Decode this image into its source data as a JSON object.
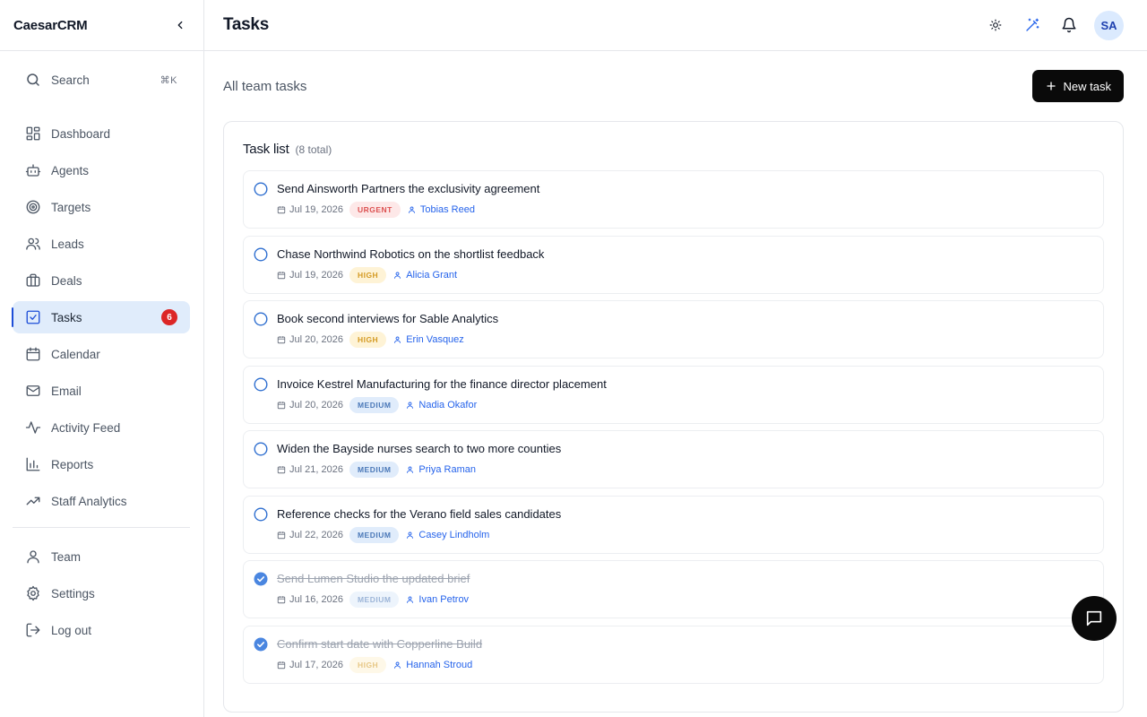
{
  "app": {
    "name": "CaesarCRM"
  },
  "sidebar": {
    "search": {
      "label": "Search",
      "shortcut": "⌘K"
    },
    "items": [
      {
        "label": "Dashboard",
        "icon": "dashboard-icon"
      },
      {
        "label": "Agents",
        "icon": "bot-icon"
      },
      {
        "label": "Targets",
        "icon": "target-icon"
      },
      {
        "label": "Leads",
        "icon": "users-icon"
      },
      {
        "label": "Deals",
        "icon": "briefcase-icon"
      },
      {
        "label": "Tasks",
        "icon": "checkbox-icon",
        "active": true,
        "badge": "6"
      },
      {
        "label": "Calendar",
        "icon": "calendar-icon"
      },
      {
        "label": "Email",
        "icon": "mail-icon"
      },
      {
        "label": "Activity Feed",
        "icon": "activity-icon"
      },
      {
        "label": "Reports",
        "icon": "bar-chart-icon"
      },
      {
        "label": "Staff Analytics",
        "icon": "trending-up-icon"
      }
    ],
    "bottom_items": [
      {
        "label": "Team",
        "icon": "user-icon"
      },
      {
        "label": "Settings",
        "icon": "gear-icon"
      },
      {
        "label": "Log out",
        "icon": "logout-icon"
      }
    ]
  },
  "header": {
    "title": "Tasks",
    "avatar_initials": "SA"
  },
  "main": {
    "subtitle": "All team tasks",
    "new_task_label": "New task",
    "card_title": "Task list",
    "card_count": "(8 total)"
  },
  "tasks": [
    {
      "title": "Send Ainsworth Partners the exclusivity agreement",
      "date": "Jul 19, 2026",
      "priority": "URGENT",
      "assignee": "Tobias Reed",
      "done": false
    },
    {
      "title": "Chase Northwind Robotics on the shortlist feedback",
      "date": "Jul 19, 2026",
      "priority": "HIGH",
      "assignee": "Alicia Grant",
      "done": false
    },
    {
      "title": "Book second interviews for Sable Analytics",
      "date": "Jul 20, 2026",
      "priority": "HIGH",
      "assignee": "Erin Vasquez",
      "done": false
    },
    {
      "title": "Invoice Kestrel Manufacturing for the finance director placement",
      "date": "Jul 20, 2026",
      "priority": "MEDIUM",
      "assignee": "Nadia Okafor",
      "done": false
    },
    {
      "title": "Widen the Bayside nurses search to two more counties",
      "date": "Jul 21, 2026",
      "priority": "MEDIUM",
      "assignee": "Priya Raman",
      "done": false
    },
    {
      "title": "Reference checks for the Verano field sales candidates",
      "date": "Jul 22, 2026",
      "priority": "MEDIUM",
      "assignee": "Casey Lindholm",
      "done": false
    },
    {
      "title": "Send Lumen Studio the updated brief",
      "date": "Jul 16, 2026",
      "priority": "MEDIUM",
      "assignee": "Ivan Petrov",
      "done": true
    },
    {
      "title": "Confirm start date with Copperline Build",
      "date": "Jul 17, 2026",
      "priority": "HIGH",
      "assignee": "Hannah Stroud",
      "done": true
    }
  ],
  "colors": {
    "accent": "#1d4ed8",
    "badge": "#dc2626",
    "primary_button": "#0a0a0a"
  }
}
